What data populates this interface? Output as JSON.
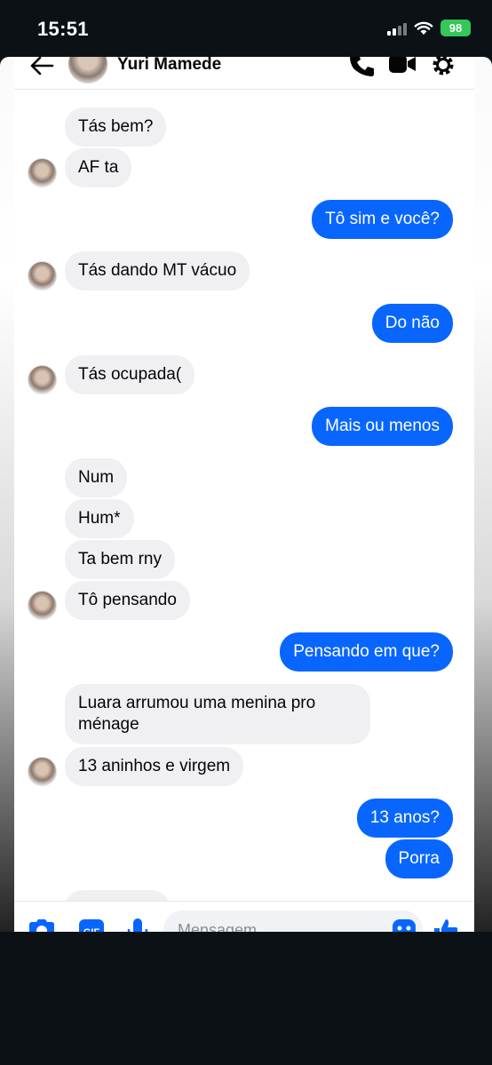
{
  "status_bar": {
    "time": "15:51",
    "battery": "98"
  },
  "header": {
    "contact_name": "Yuri Mamede"
  },
  "messages": [
    {
      "side": "in",
      "text": "Tás bem?"
    },
    {
      "side": "in",
      "text": "AF ta"
    },
    {
      "side": "out",
      "text": "Tô sim e você?"
    },
    {
      "side": "in",
      "text": "Tás dando MT vácuo"
    },
    {
      "side": "out",
      "text": "Do não"
    },
    {
      "side": "in",
      "text": "Tás ocupada("
    },
    {
      "side": "out",
      "text": "Mais ou menos"
    },
    {
      "side": "in",
      "text": "Num"
    },
    {
      "side": "in",
      "text": "Hum*"
    },
    {
      "side": "in",
      "text": "Ta bem rny"
    },
    {
      "side": "in",
      "text": "Tô pensando"
    },
    {
      "side": "out",
      "text": "Pensando em que?"
    },
    {
      "side": "in",
      "text": "Luara arrumou uma menina pro ménage"
    },
    {
      "side": "in",
      "text": "13 aninhos e virgem"
    },
    {
      "side": "out",
      "text": "13 anos?"
    },
    {
      "side": "out",
      "text": "Porra"
    }
  ],
  "composer": {
    "placeholder": "Mensagem"
  },
  "colors": {
    "accent": "#0866ff",
    "incoming_bubble": "#f0f0f3",
    "battery": "#34c759"
  }
}
